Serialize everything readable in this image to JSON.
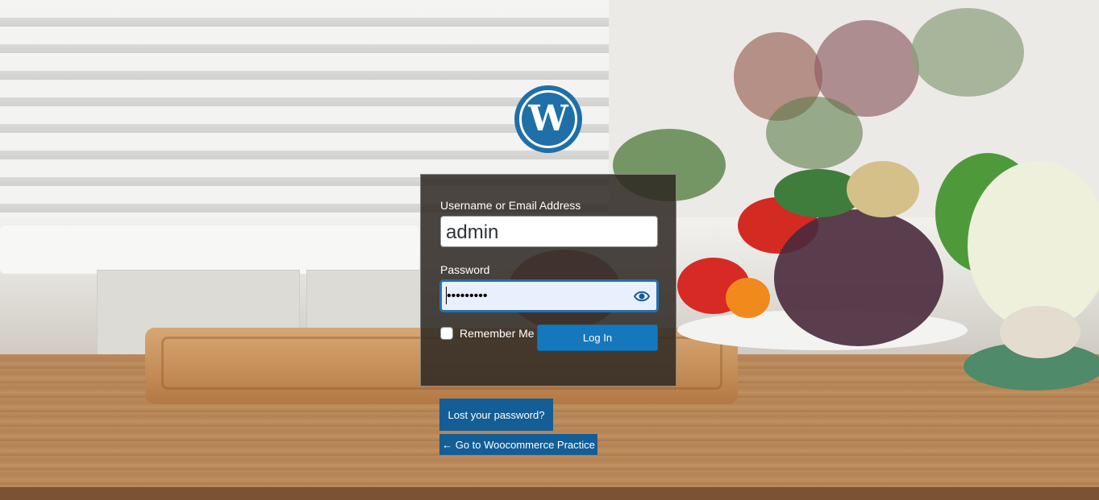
{
  "logo": {
    "icon": "wordpress-logo",
    "color": "#1f6fa8",
    "glyph": "W"
  },
  "login_form": {
    "username_label": "Username or Email Address",
    "username_value": "admin",
    "password_label": "Password",
    "password_value": "•••••••••",
    "show_password_icon": "eye-icon",
    "remember_label": "Remember Me",
    "remember_checked": false,
    "submit_label": "Log In"
  },
  "links": {
    "lost_password": "Lost your password?",
    "back_to_site": "← Go to Woocommerce Practice"
  },
  "colors": {
    "accent": "#2271b1",
    "button": "#1578bd",
    "link_bg": "#135e96"
  }
}
